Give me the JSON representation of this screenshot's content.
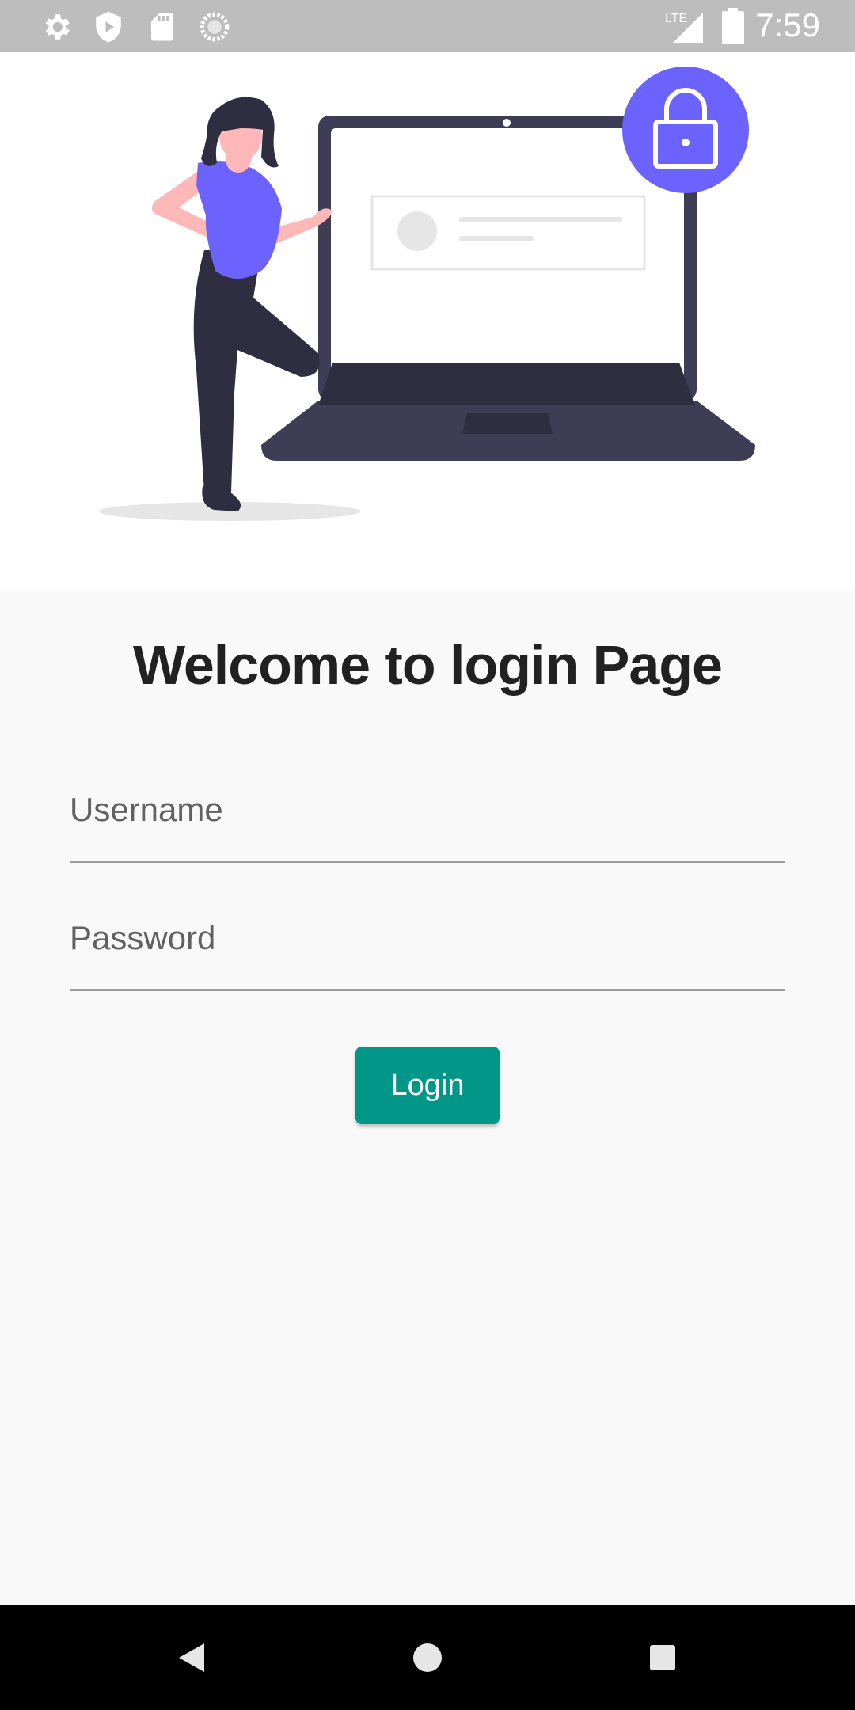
{
  "status_bar": {
    "time": "7:59",
    "network": "LTE",
    "left_icons": [
      "gear-icon",
      "shield-play-icon",
      "sd-card-icon",
      "sync-circle-icon"
    ],
    "right_icons": [
      "signal-icon",
      "battery-icon"
    ]
  },
  "hero": {
    "image_name": "login-illustration",
    "colors": {
      "accent": "#6c63ff",
      "dark": "#3f3d56",
      "skin": "#ffb8b8",
      "hair": "#2f2e41"
    }
  },
  "login": {
    "title": "Welcome to login Page",
    "username_placeholder": "Username",
    "password_placeholder": "Password",
    "button_label": "Login",
    "button_color": "#009688"
  },
  "nav_bar": {
    "buttons": [
      "back-icon",
      "home-icon",
      "recents-icon"
    ]
  }
}
